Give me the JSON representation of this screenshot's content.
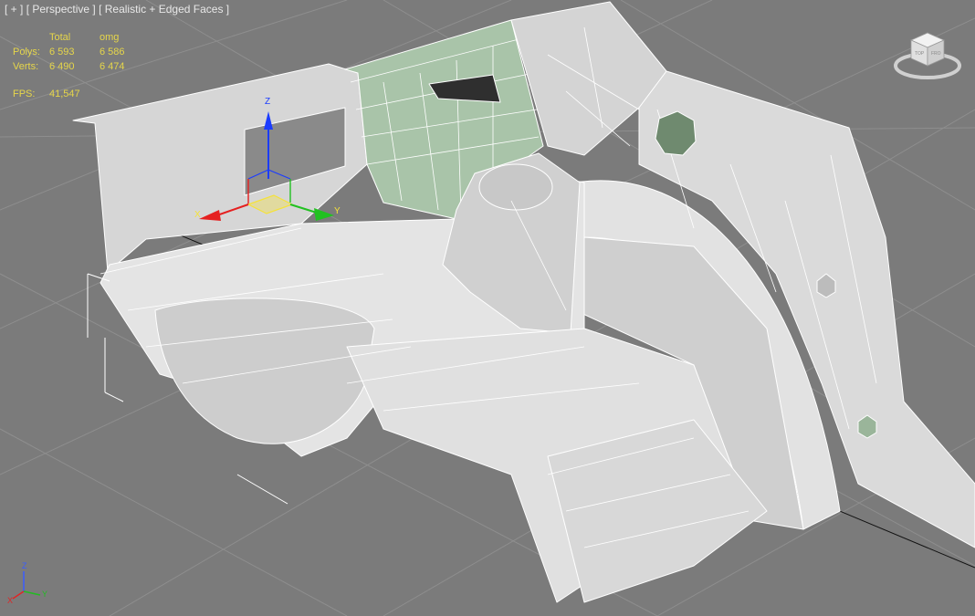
{
  "viewport": {
    "label_plus": "[ + ]",
    "label_view": "[ Perspective ]",
    "label_shading": "[ Realistic + Edged Faces ]"
  },
  "stats": {
    "headers": [
      "",
      "Total",
      "omg"
    ],
    "polys_label": "Polys:",
    "polys_total": "6 593",
    "polys_sel": "6 586",
    "verts_label": "Verts:",
    "verts_total": "6 490",
    "verts_sel": "6 474",
    "fps_label": "FPS:",
    "fps_value": "41,547"
  },
  "gizmo": {
    "x_label": "X",
    "y_label": "Y",
    "z_label": "Z"
  },
  "viewcube": {
    "face_top": "TOP",
    "face_front": "FRO"
  },
  "colors": {
    "grid": "#8c8c8c",
    "background": "#7b7b7b",
    "mesh_fill": "#d9d9d9",
    "mesh_edge": "#ffffff",
    "glass": "#a9c4a9",
    "stats_text": "#e6d64a"
  }
}
